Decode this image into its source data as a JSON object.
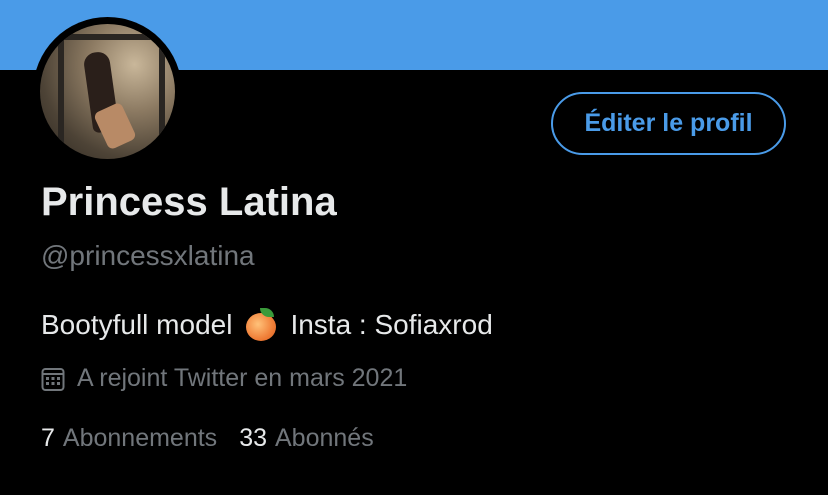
{
  "profile": {
    "name": "Princess Latina",
    "handle": "@princessxlatina",
    "bio_text": "Bootyfull model",
    "bio_emoji": "peach",
    "bio_suffix": "Insta : Sofiaxrod",
    "joined": "A rejoint Twitter en mars 2021",
    "edit_button": "Éditer le profil"
  },
  "stats": {
    "following_count": "7",
    "following_label": "Abonnements",
    "followers_count": "33",
    "followers_label": "Abonnés"
  },
  "colors": {
    "banner": "#4a9be8",
    "accent": "#4a9be8",
    "background": "#000000",
    "secondary_text": "#71767b"
  },
  "icons": {
    "joined": "calendar-icon"
  }
}
